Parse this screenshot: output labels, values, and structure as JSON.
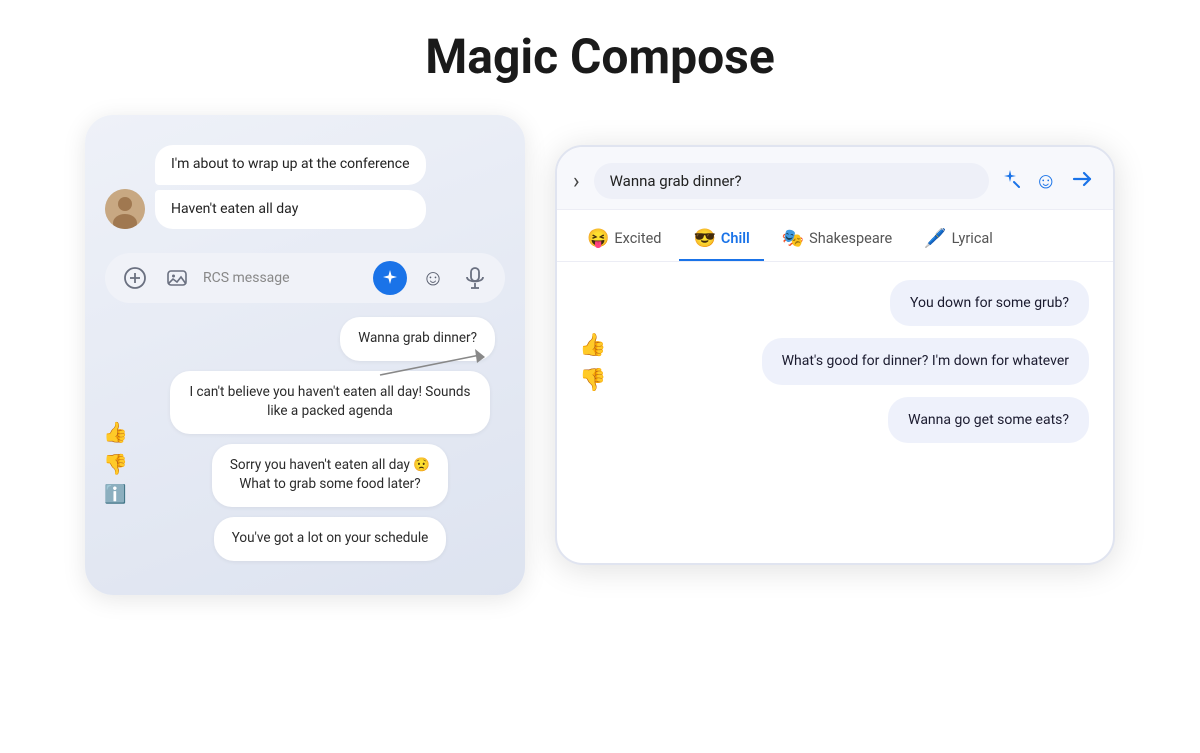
{
  "page": {
    "title": "Magic Compose"
  },
  "left_phone": {
    "messages": [
      {
        "text": "I'm about to wrap up at the conference"
      },
      {
        "text": "Haven't eaten all day"
      }
    ],
    "input_placeholder": "RCS message",
    "suggestions": [
      {
        "text": "Wanna grab dinner?",
        "align": "right"
      },
      {
        "text": "I can't believe you haven't eaten all day! Sounds like a packed agenda",
        "align": "center"
      },
      {
        "text": "Sorry you haven't eaten all day 😟\nWhat to grab some food later?",
        "align": "center"
      },
      {
        "text": "You've got a lot on your schedule",
        "align": "center"
      }
    ]
  },
  "right_phone": {
    "compose_value": "Wanna grab dinner?",
    "tabs": [
      {
        "emoji": "😝",
        "label": "Excited",
        "active": false
      },
      {
        "emoji": "😎",
        "label": "Chill",
        "active": true
      },
      {
        "emoji": "🎭",
        "label": "Shakespeare",
        "active": false
      },
      {
        "emoji": "🖊️",
        "label": "Lyrical",
        "active": false
      }
    ],
    "suggestions": [
      {
        "text": "You down for some grub?"
      },
      {
        "text": "What's good for dinner? I'm down for whatever"
      },
      {
        "text": "Wanna go get some eats?"
      }
    ]
  }
}
